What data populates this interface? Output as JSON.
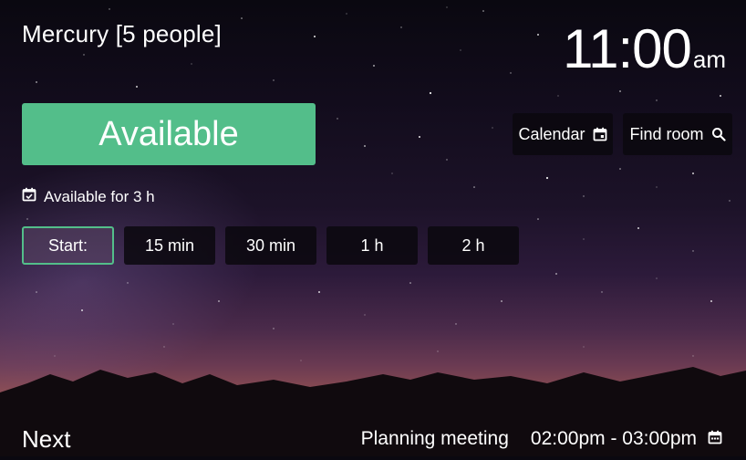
{
  "room": {
    "name": "Mercury",
    "capacity": "[5 people]"
  },
  "clock": {
    "time": "11:00",
    "ampm": "am"
  },
  "status": {
    "label": "Available",
    "color": "#53be8a"
  },
  "actions": {
    "calendar": {
      "label": "Calendar",
      "icon": "calendar-icon"
    },
    "find_room": {
      "label": "Find room",
      "icon": "search-icon"
    }
  },
  "availability": {
    "text": "Available for 3 h",
    "icon": "calendar-check-icon"
  },
  "quick_book": {
    "start_label": "Start:",
    "options": [
      "15 min",
      "30 min",
      "1 h",
      "2 h"
    ]
  },
  "next": {
    "label": "Next",
    "meeting_title": "Planning meeting",
    "meeting_time": "02:00pm - 03:00pm",
    "icon": "calendar-icon"
  }
}
